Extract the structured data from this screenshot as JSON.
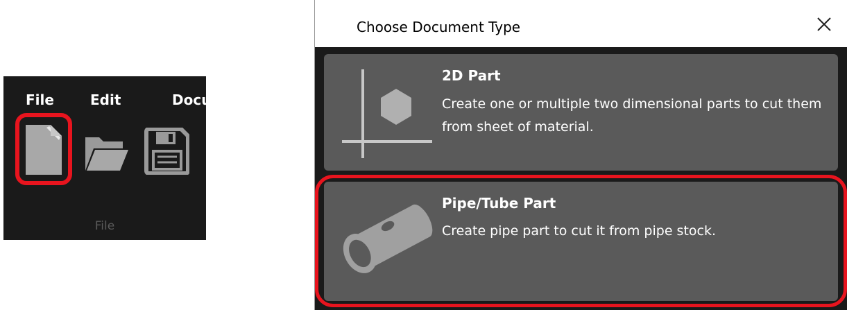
{
  "ribbon": {
    "menu": {
      "file": "File",
      "edit": "Edit",
      "document": "Docu"
    },
    "group_label": "File",
    "buttons": [
      {
        "name": "new-document",
        "icon": "new-document-icon"
      },
      {
        "name": "open",
        "icon": "folder-open-icon"
      },
      {
        "name": "save",
        "icon": "floppy-disk-icon"
      }
    ],
    "highlight_color": "#e8141e"
  },
  "dialog": {
    "title": "Choose Document Type",
    "close_icon": "close-icon",
    "options": [
      {
        "title": "2D Part",
        "description": "Create one or multiple two dimensional parts to cut them from sheet of material.",
        "icon": "hexagon-part-icon"
      },
      {
        "title": "Pipe/Tube Part",
        "description": "Create pipe part to cut it from pipe stock.",
        "icon": "pipe-icon",
        "highlighted": true
      }
    ],
    "card_color": "#5a5a5a",
    "highlight_color": "#e8141e"
  }
}
